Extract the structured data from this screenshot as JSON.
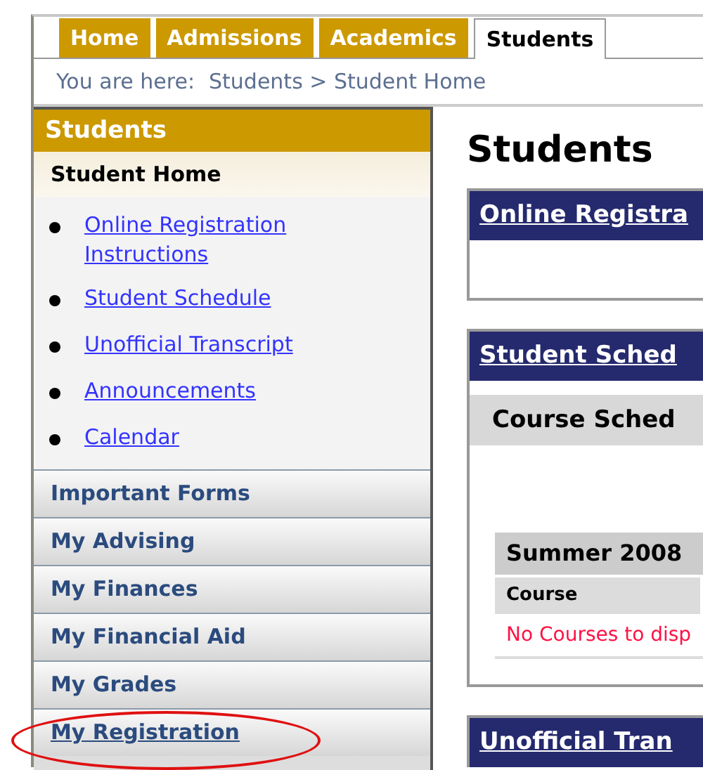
{
  "tabs": [
    {
      "label": "Home",
      "selected": false
    },
    {
      "label": "Admissions",
      "selected": false
    },
    {
      "label": "Academics",
      "selected": false
    },
    {
      "label": "Students",
      "selected": true
    }
  ],
  "breadcrumb": {
    "prefix": "You are here:",
    "path": "Students > Student Home"
  },
  "sidebar": {
    "title": "Students",
    "section": "Student Home",
    "links": [
      "Online Registration Instructions",
      "Student Schedule",
      "Unofficial Transcript",
      "Announcements",
      "Calendar"
    ],
    "items": [
      {
        "label": "Important Forms",
        "circled": false
      },
      {
        "label": "My Advising",
        "circled": false
      },
      {
        "label": "My Finances",
        "circled": false
      },
      {
        "label": "My Financial Aid",
        "circled": false
      },
      {
        "label": "My Grades",
        "circled": false
      },
      {
        "label": "My Registration",
        "circled": true
      }
    ]
  },
  "main": {
    "title": "Students",
    "panels": [
      {
        "title": "Online Registra"
      },
      {
        "title": "Student Sched",
        "subheading": "Course Sched",
        "term": "Summer 2008",
        "column_1": "Course",
        "empty_message": "No Courses to disp"
      },
      {
        "title": "Unofficial Tran"
      }
    ]
  }
}
